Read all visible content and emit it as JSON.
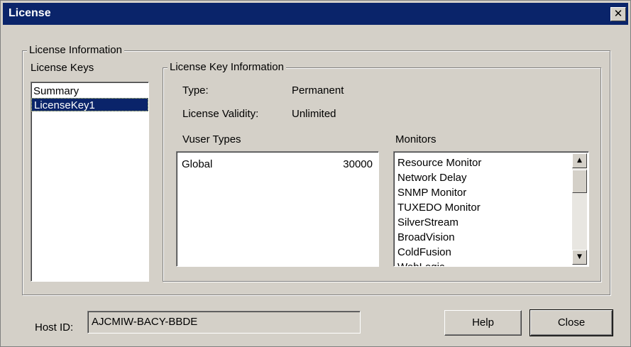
{
  "window": {
    "title": "License",
    "close_glyph": "✕"
  },
  "license_info": {
    "group_label": "License Information",
    "keys_label": "License Keys",
    "keys": [
      {
        "label": "Summary",
        "selected": false
      },
      {
        "label": "LicenseKey1",
        "selected": true
      }
    ]
  },
  "key_info": {
    "group_label": "License Key Information",
    "type_label": "Type:",
    "type_value": "Permanent",
    "validity_label": "License Validity:",
    "validity_value": "Unlimited",
    "vuser_types_label": "Vuser Types",
    "vuser_types": [
      {
        "name": "Global",
        "count": "30000"
      }
    ],
    "monitors_label": "Monitors",
    "monitors": [
      "Resource Monitor",
      "Network Delay",
      "SNMP Monitor",
      "TUXEDO Monitor",
      "SilverStream",
      "BroadVision",
      "ColdFusion",
      "WebLogic"
    ]
  },
  "footer": {
    "host_id_label": "Host ID:",
    "host_id_value": "AJCMIW-BACY-BBDE",
    "help_label": "Help",
    "close_label": "Close"
  },
  "colors": {
    "title_bar": "#0a246a",
    "window_bg": "#d4d0c8",
    "selection": "#0a246a"
  },
  "icons": {
    "scroll_up": "scroll-up-arrow-icon",
    "scroll_down": "scroll-down-arrow-icon",
    "close": "close-icon"
  }
}
